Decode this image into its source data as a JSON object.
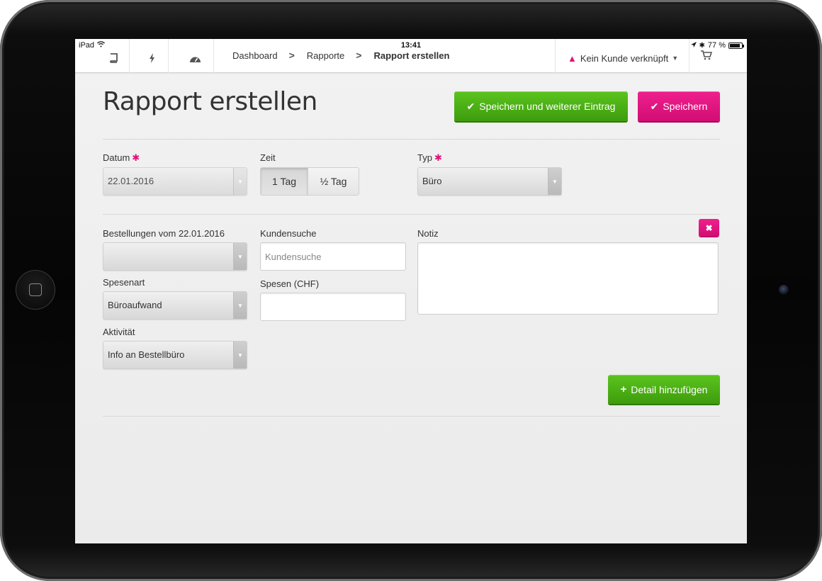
{
  "status_bar": {
    "device": "iPad",
    "time": "13:41",
    "battery": "77 %"
  },
  "nav": {
    "breadcrumbs": [
      {
        "label": "Dashboard"
      },
      {
        "label": "Rapporte"
      },
      {
        "label": "Rapport erstellen"
      }
    ],
    "customer_label": "Kein Kunde verknüpft"
  },
  "page": {
    "title": "Rapport erstellen",
    "save_more_label": "Speichern und weiterer Eintrag",
    "save_label": "Speichern"
  },
  "form": {
    "datum": {
      "label": "Datum",
      "value": "22.01.2016"
    },
    "zeit": {
      "label": "Zeit",
      "options": [
        "1 Tag",
        "½ Tag"
      ],
      "selected": "1 Tag"
    },
    "typ": {
      "label": "Typ",
      "value": "Büro"
    },
    "bestellungen": {
      "label": "Bestellungen vom 22.01.2016",
      "value": ""
    },
    "kundensuche": {
      "label": "Kundensuche",
      "placeholder": "Kundensuche",
      "value": ""
    },
    "notiz": {
      "label": "Notiz",
      "value": ""
    },
    "spesenart": {
      "label": "Spesenart",
      "value": "Büroaufwand"
    },
    "spesen": {
      "label": "Spesen (CHF)",
      "value": ""
    },
    "aktivitaet": {
      "label": "Aktivität",
      "value": "Info an Bestellbüro"
    },
    "add_detail_label": "Detail hinzufügen"
  },
  "colors": {
    "accent_pink": "#e0127a",
    "accent_green": "#4cae15"
  }
}
